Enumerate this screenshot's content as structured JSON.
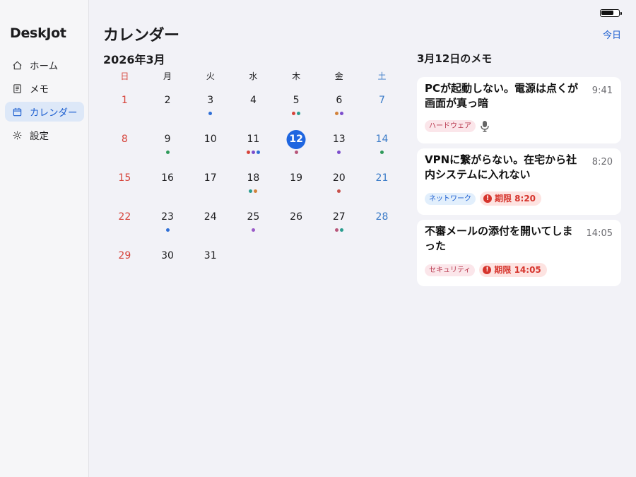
{
  "app": {
    "title": "DeskJot"
  },
  "sidebar": {
    "items": [
      {
        "label": "ホーム",
        "icon": "home-icon",
        "active": false
      },
      {
        "label": "メモ",
        "icon": "note-icon",
        "active": false
      },
      {
        "label": "カレンダー",
        "icon": "calendar-icon",
        "active": true
      },
      {
        "label": "設定",
        "icon": "gear-icon",
        "active": false
      }
    ]
  },
  "header": {
    "title": "カレンダー",
    "today_label": "今日"
  },
  "calendar": {
    "month_label": "2026年3月",
    "weekdays": [
      "日",
      "月",
      "火",
      "水",
      "木",
      "金",
      "土"
    ],
    "selected_day": 12,
    "weeks": [
      [
        {
          "day": "1",
          "dots": []
        },
        {
          "day": "2",
          "dots": []
        },
        {
          "day": "3",
          "dots": [
            "#2f6fd6"
          ]
        },
        {
          "day": "4",
          "dots": []
        },
        {
          "day": "5",
          "dots": [
            "#d6433a",
            "#2a9d8f"
          ]
        },
        {
          "day": "6",
          "dots": [
            "#d2823a",
            "#7c4dcc"
          ]
        },
        {
          "day": "7",
          "dots": []
        }
      ],
      [
        {
          "day": "8",
          "dots": []
        },
        {
          "day": "9",
          "dots": [
            "#2f9a5a"
          ]
        },
        {
          "day": "10",
          "dots": []
        },
        {
          "day": "11",
          "dots": [
            "#d6433a",
            "#7c4dcc",
            "#2f6fd6"
          ]
        },
        {
          "day": "12",
          "dots": [
            "#b8567a"
          ]
        },
        {
          "day": "13",
          "dots": [
            "#7c4dcc"
          ]
        },
        {
          "day": "14",
          "dots": [
            "#2f9a5a"
          ]
        }
      ],
      [
        {
          "day": "15",
          "dots": []
        },
        {
          "day": "16",
          "dots": []
        },
        {
          "day": "17",
          "dots": []
        },
        {
          "day": "18",
          "dots": [
            "#2a9d8f",
            "#d2823a"
          ]
        },
        {
          "day": "19",
          "dots": []
        },
        {
          "day": "20",
          "dots": [
            "#c8504a"
          ]
        },
        {
          "day": "21",
          "dots": []
        }
      ],
      [
        {
          "day": "22",
          "dots": []
        },
        {
          "day": "23",
          "dots": [
            "#2f6fd6"
          ]
        },
        {
          "day": "24",
          "dots": []
        },
        {
          "day": "25",
          "dots": [
            "#9a5ac8"
          ]
        },
        {
          "day": "26",
          "dots": []
        },
        {
          "day": "27",
          "dots": [
            "#b8567a",
            "#2a9d8f"
          ]
        },
        {
          "day": "28",
          "dots": []
        }
      ],
      [
        {
          "day": "29",
          "dots": []
        },
        {
          "day": "30",
          "dots": []
        },
        {
          "day": "31",
          "dots": []
        }
      ]
    ]
  },
  "memos": {
    "title": "3月12日のメモ",
    "items": [
      {
        "text": "PCが起動しない。電源は点くが画面が真っ暗",
        "time": "9:41",
        "tag": "ハードウェア",
        "tag_kind": "hw",
        "has_voice": true,
        "deadline": ""
      },
      {
        "text": "VPNに繋がらない。在宅から社内システムに入れない",
        "time": "8:20",
        "tag": "ネットワーク",
        "tag_kind": "nw",
        "has_voice": false,
        "deadline": "期限 8:20"
      },
      {
        "text": "不審メールの添付を開いてしまった",
        "time": "14:05",
        "tag": "セキュリティ",
        "tag_kind": "sec",
        "has_voice": false,
        "deadline": "期限 14:05"
      }
    ]
  },
  "colors": {
    "accent": "#1f66e0",
    "sunday": "#d6433a",
    "saturday": "#3a7bc8",
    "deadline": "#d6342c"
  }
}
